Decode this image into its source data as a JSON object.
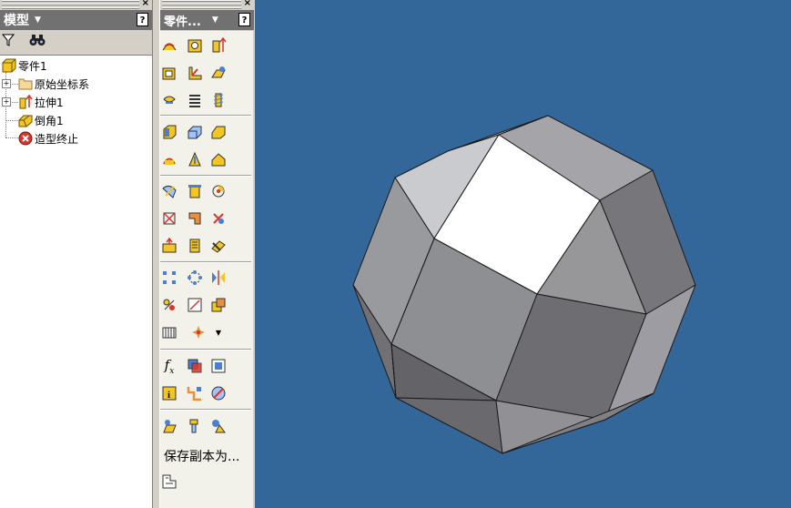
{
  "model_panel": {
    "title": "模型",
    "help": "?",
    "close": "×",
    "toolbar": {
      "filter_icon": "filter-icon",
      "find_icon": "binoculars-icon"
    },
    "tree": [
      {
        "label": "零件1",
        "icon": "part-icon"
      },
      {
        "label": "原始坐标系",
        "icon": "folder-icon",
        "expander": "+"
      },
      {
        "label": "拉伸1",
        "icon": "extrude-icon",
        "expander": "+"
      },
      {
        "label": "倒角1",
        "icon": "chamfer-icon"
      },
      {
        "label": "造型终止",
        "icon": "end-of-part-icon"
      }
    ]
  },
  "feature_panel": {
    "title": "零件...",
    "help": "?",
    "close": "×",
    "save_copy": "保存副本为..."
  },
  "colors": {
    "viewport": "#336699",
    "panel_title": "#717171",
    "accent_yellow": "#f3c623",
    "accent_red": "#d9362b"
  }
}
